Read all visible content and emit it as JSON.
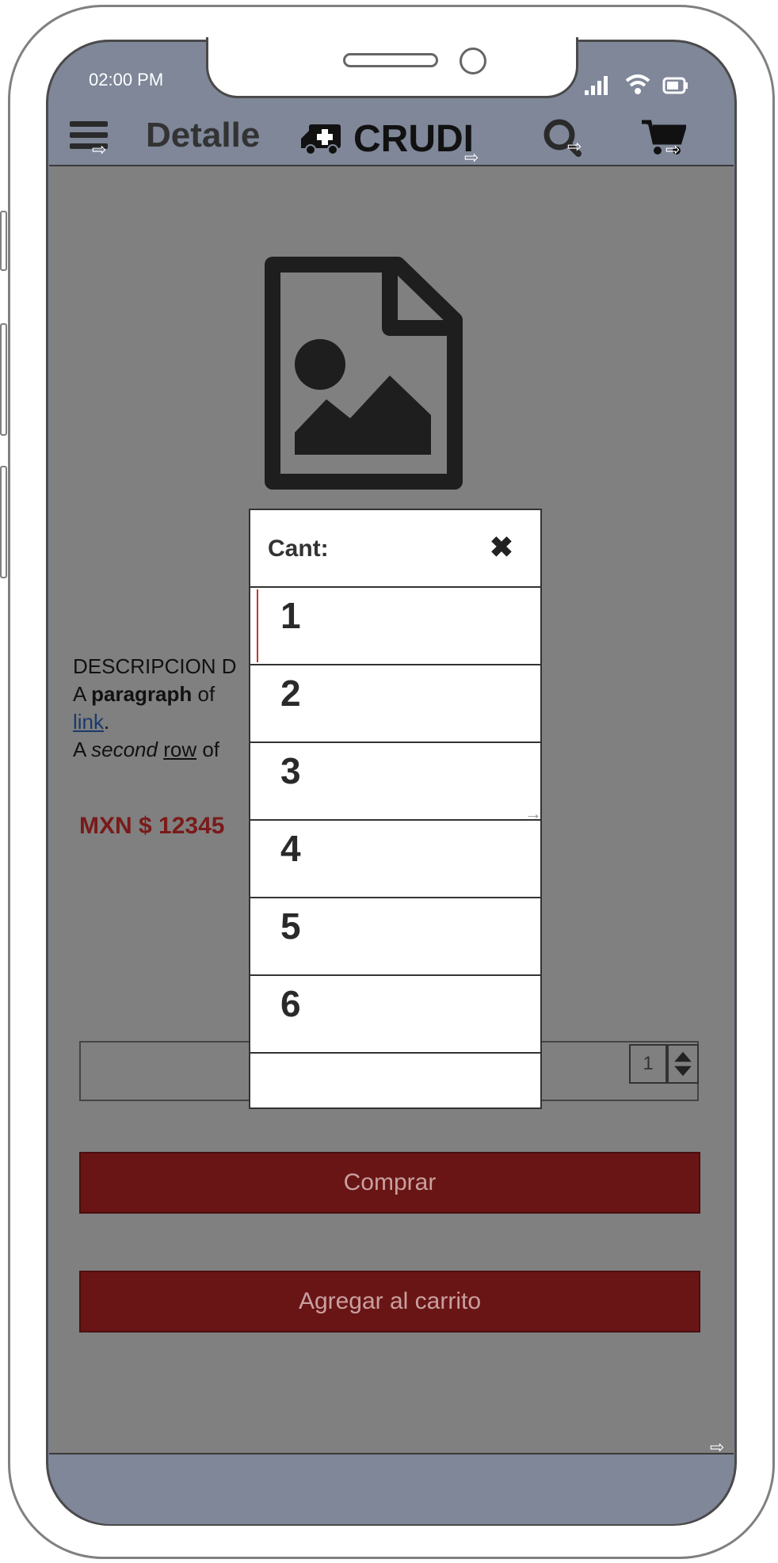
{
  "status_bar": {
    "time": "02:00 PM"
  },
  "header": {
    "title": "Detalle",
    "brand": "CRUDI"
  },
  "product": {
    "description": {
      "heading": "DESCRIPCION D",
      "p1_a": "A ",
      "p1_bold": "paragraph",
      "p1_b": " of",
      "link": "link",
      "p1_end": ".",
      "p2_a": "A ",
      "p2_italic": "second",
      "p2_b": " ",
      "p2_u": "row",
      "p2_c": " of"
    },
    "price": "MXN $ 12345",
    "quantity": "1"
  },
  "buttons": {
    "buy": "Comprar",
    "add_to_cart": "Agregar al carrito"
  },
  "quantity_dialog": {
    "title": "Cant:",
    "close": "✖",
    "options": [
      "1",
      "2",
      "3",
      "4",
      "5",
      "6",
      ""
    ]
  },
  "icons": [
    "menu-icon",
    "ambulance-icon",
    "search-icon",
    "cart-icon",
    "image-file-icon",
    "signal-icon",
    "wifi-icon",
    "battery-icon",
    "close-icon"
  ],
  "colors": {
    "primary_button": "#6a1515",
    "price": "#7a1a1a",
    "header": "#7f8799"
  }
}
